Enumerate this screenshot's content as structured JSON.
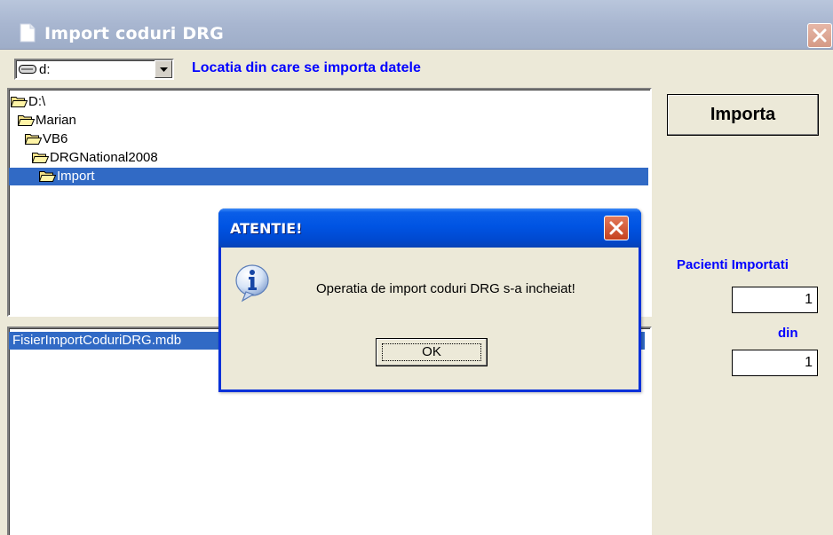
{
  "window": {
    "title": "Import coduri DRG"
  },
  "drive": {
    "value": "d:"
  },
  "location_label": "Locatia din care se importa datele",
  "directories": [
    {
      "name": "D:\\",
      "selected": false
    },
    {
      "name": "Marian",
      "selected": false
    },
    {
      "name": "VB6",
      "selected": false
    },
    {
      "name": "DRGNational2008",
      "selected": false
    },
    {
      "name": "Import",
      "selected": true
    }
  ],
  "files": [
    {
      "name": "FisierImportCoduriDRG.mdb",
      "selected": true
    }
  ],
  "import_button": "Importa",
  "patients": {
    "label": "Pacienti Importati",
    "imported": "1",
    "of_label": "din",
    "total": "1"
  },
  "dialog": {
    "title": "ATENTIE!",
    "message": "Operatia de import coduri DRG s-a incheiat!",
    "ok_label": "OK",
    "icon": "info-icon"
  },
  "colors": {
    "selection": "#316ac5",
    "label_blue": "#0000ff",
    "dialog_titlebar": "#0054e3",
    "window_bg": "#ece9d8"
  }
}
